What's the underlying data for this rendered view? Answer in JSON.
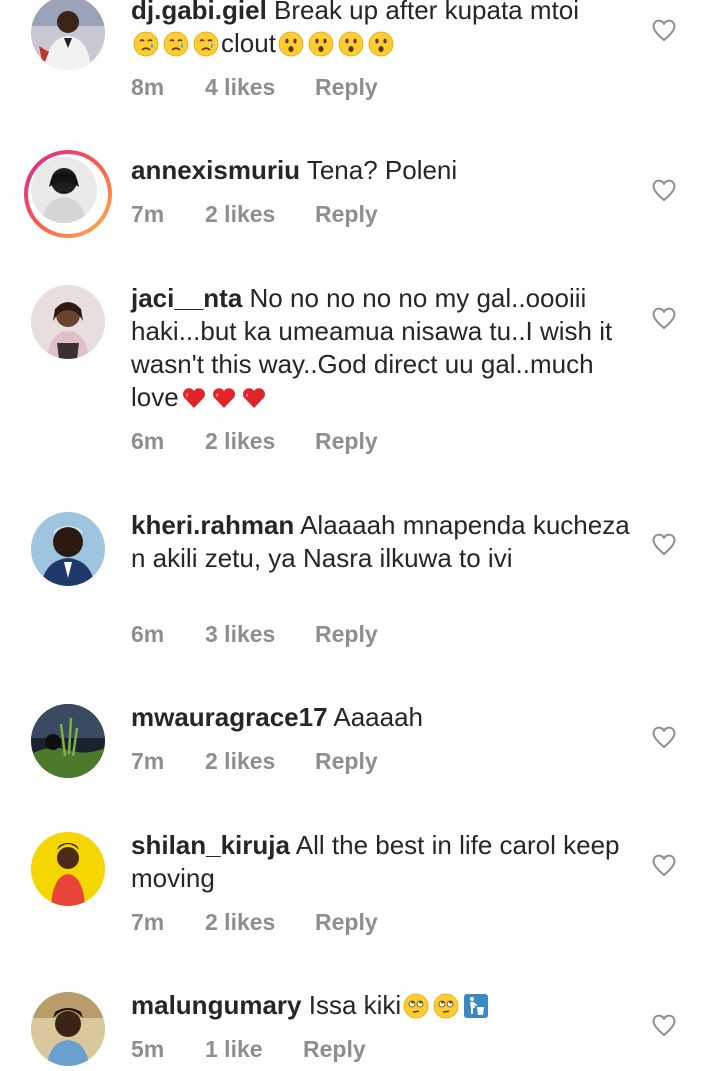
{
  "comments": [
    {
      "username": "dj.gabi.giel",
      "text_a": "Break up after kupata mtoi ",
      "text_b": "clout",
      "emojis_a": [
        "crying-face",
        "crying-face",
        "crying-face"
      ],
      "emojis_b": [
        "hushed-face",
        "hushed-face",
        "hushed-face",
        "hushed-face"
      ],
      "time": "8m",
      "likes": "4 likes",
      "reply": "Reply"
    },
    {
      "username": "annexismuriu",
      "text": "Tena? Poleni",
      "time": "7m",
      "likes": "2 likes",
      "reply": "Reply"
    },
    {
      "username": "jaci__nta",
      "text": "No no no no no my gal..oooiii haki...but ka umeamua nisawa tu..I wish it wasn't this way..God direct uu gal..much love",
      "emojis": [
        "red-heart",
        "red-heart",
        "red-heart"
      ],
      "time": "6m",
      "likes": "2 likes",
      "reply": "Reply"
    },
    {
      "username": "kheri.rahman",
      "text": "Alaaaah mnapenda kucheza n akili zetu, ya Nasra ilkuwa to ivi",
      "time": "6m",
      "likes": "3 likes",
      "reply": "Reply"
    },
    {
      "username": "mwauragrace17",
      "text": "Aaaaah",
      "time": "7m",
      "likes": "2 likes",
      "reply": "Reply"
    },
    {
      "username": "shilan_kiruja",
      "text": "All the best in life carol keep moving",
      "time": "7m",
      "likes": "2 likes",
      "reply": "Reply"
    },
    {
      "username": "malungumary",
      "text": "Issa kiki",
      "emojis": [
        "eye-roll-face",
        "eye-roll-face",
        "litter-bin-sign"
      ],
      "time": "5m",
      "likes": "1 like",
      "reply": "Reply"
    }
  ],
  "icons": {
    "like": "heart-outline-icon"
  },
  "colors": {
    "text": "#262626",
    "meta": "#8e8e8e",
    "story_ring": "#d6249f"
  }
}
